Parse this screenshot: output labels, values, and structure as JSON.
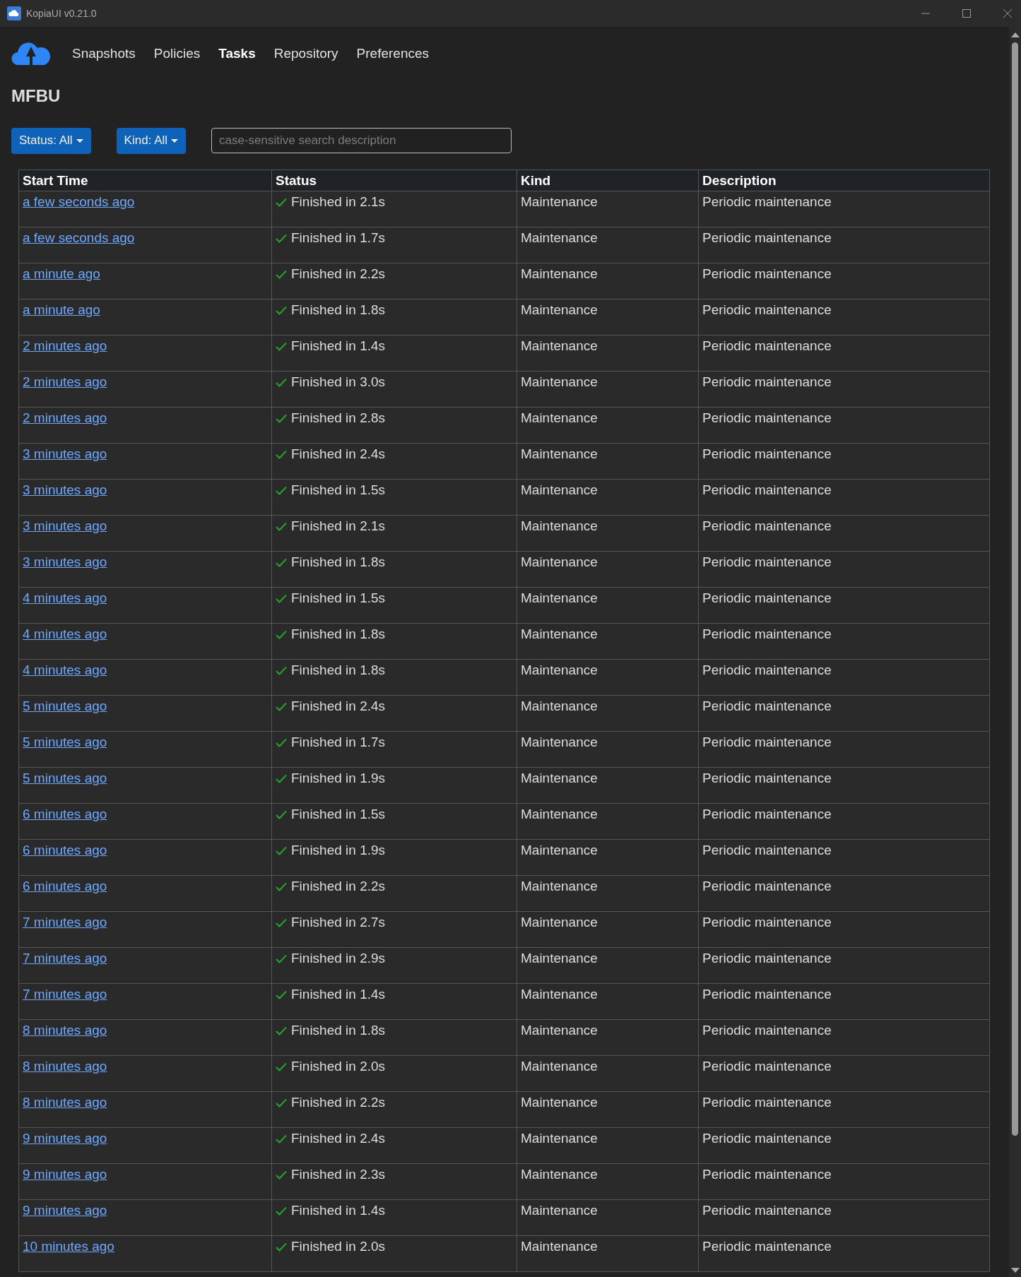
{
  "window": {
    "title": "KopiaUI v0.21.0"
  },
  "nav": [
    {
      "label": "Snapshots",
      "selected": false
    },
    {
      "label": "Policies",
      "selected": false
    },
    {
      "label": "Tasks",
      "selected": true
    },
    {
      "label": "Repository",
      "selected": false
    },
    {
      "label": "Preferences",
      "selected": false
    }
  ],
  "page_title": "MFBU",
  "filters": [
    {
      "label": "Status: All"
    },
    {
      "label": "Kind: All"
    }
  ],
  "search": {
    "placeholder": "case-sensitive search description"
  },
  "table": {
    "columns": [
      "Start Time",
      "Status",
      "Kind",
      "Description"
    ],
    "rows": [
      {
        "start_time": "a few seconds ago",
        "status": "Finished in 2.1s",
        "kind": "Maintenance",
        "description": "Periodic maintenance"
      },
      {
        "start_time": "a few seconds ago",
        "status": "Finished in 1.7s",
        "kind": "Maintenance",
        "description": "Periodic maintenance"
      },
      {
        "start_time": "a minute ago",
        "status": "Finished in 2.2s",
        "kind": "Maintenance",
        "description": "Periodic maintenance"
      },
      {
        "start_time": "a minute ago",
        "status": "Finished in 1.8s",
        "kind": "Maintenance",
        "description": "Periodic maintenance"
      },
      {
        "start_time": "2 minutes ago",
        "status": "Finished in 1.4s",
        "kind": "Maintenance",
        "description": "Periodic maintenance"
      },
      {
        "start_time": "2 minutes ago",
        "status": "Finished in 3.0s",
        "kind": "Maintenance",
        "description": "Periodic maintenance"
      },
      {
        "start_time": "2 minutes ago",
        "status": "Finished in 2.8s",
        "kind": "Maintenance",
        "description": "Periodic maintenance"
      },
      {
        "start_time": "3 minutes ago",
        "status": "Finished in 2.4s",
        "kind": "Maintenance",
        "description": "Periodic maintenance"
      },
      {
        "start_time": "3 minutes ago",
        "status": "Finished in 1.5s",
        "kind": "Maintenance",
        "description": "Periodic maintenance"
      },
      {
        "start_time": "3 minutes ago",
        "status": "Finished in 2.1s",
        "kind": "Maintenance",
        "description": "Periodic maintenance"
      },
      {
        "start_time": "3 minutes ago",
        "status": "Finished in 1.8s",
        "kind": "Maintenance",
        "description": "Periodic maintenance"
      },
      {
        "start_time": "4 minutes ago",
        "status": "Finished in 1.5s",
        "kind": "Maintenance",
        "description": "Periodic maintenance"
      },
      {
        "start_time": "4 minutes ago",
        "status": "Finished in 1.8s",
        "kind": "Maintenance",
        "description": "Periodic maintenance"
      },
      {
        "start_time": "4 minutes ago",
        "status": "Finished in 1.8s",
        "kind": "Maintenance",
        "description": "Periodic maintenance"
      },
      {
        "start_time": "5 minutes ago",
        "status": "Finished in 2.4s",
        "kind": "Maintenance",
        "description": "Periodic maintenance"
      },
      {
        "start_time": "5 minutes ago",
        "status": "Finished in 1.7s",
        "kind": "Maintenance",
        "description": "Periodic maintenance"
      },
      {
        "start_time": "5 minutes ago",
        "status": "Finished in 1.9s",
        "kind": "Maintenance",
        "description": "Periodic maintenance"
      },
      {
        "start_time": "6 minutes ago",
        "status": "Finished in 1.5s",
        "kind": "Maintenance",
        "description": "Periodic maintenance"
      },
      {
        "start_time": "6 minutes ago",
        "status": "Finished in 1.9s",
        "kind": "Maintenance",
        "description": "Periodic maintenance"
      },
      {
        "start_time": "6 minutes ago",
        "status": "Finished in 2.2s",
        "kind": "Maintenance",
        "description": "Periodic maintenance"
      },
      {
        "start_time": "7 minutes ago",
        "status": "Finished in 2.7s",
        "kind": "Maintenance",
        "description": "Periodic maintenance"
      },
      {
        "start_time": "7 minutes ago",
        "status": "Finished in 2.9s",
        "kind": "Maintenance",
        "description": "Periodic maintenance"
      },
      {
        "start_time": "7 minutes ago",
        "status": "Finished in 1.4s",
        "kind": "Maintenance",
        "description": "Periodic maintenance"
      },
      {
        "start_time": "8 minutes ago",
        "status": "Finished in 1.8s",
        "kind": "Maintenance",
        "description": "Periodic maintenance"
      },
      {
        "start_time": "8 minutes ago",
        "status": "Finished in 2.0s",
        "kind": "Maintenance",
        "description": "Periodic maintenance"
      },
      {
        "start_time": "8 minutes ago",
        "status": "Finished in 2.2s",
        "kind": "Maintenance",
        "description": "Periodic maintenance"
      },
      {
        "start_time": "9 minutes ago",
        "status": "Finished in 2.4s",
        "kind": "Maintenance",
        "description": "Periodic maintenance"
      },
      {
        "start_time": "9 minutes ago",
        "status": "Finished in 2.3s",
        "kind": "Maintenance",
        "description": "Periodic maintenance"
      },
      {
        "start_time": "9 minutes ago",
        "status": "Finished in 1.4s",
        "kind": "Maintenance",
        "description": "Periodic maintenance"
      },
      {
        "start_time": "10 minutes ago",
        "status": "Finished in 2.0s",
        "kind": "Maintenance",
        "description": "Periodic maintenance"
      }
    ]
  }
}
